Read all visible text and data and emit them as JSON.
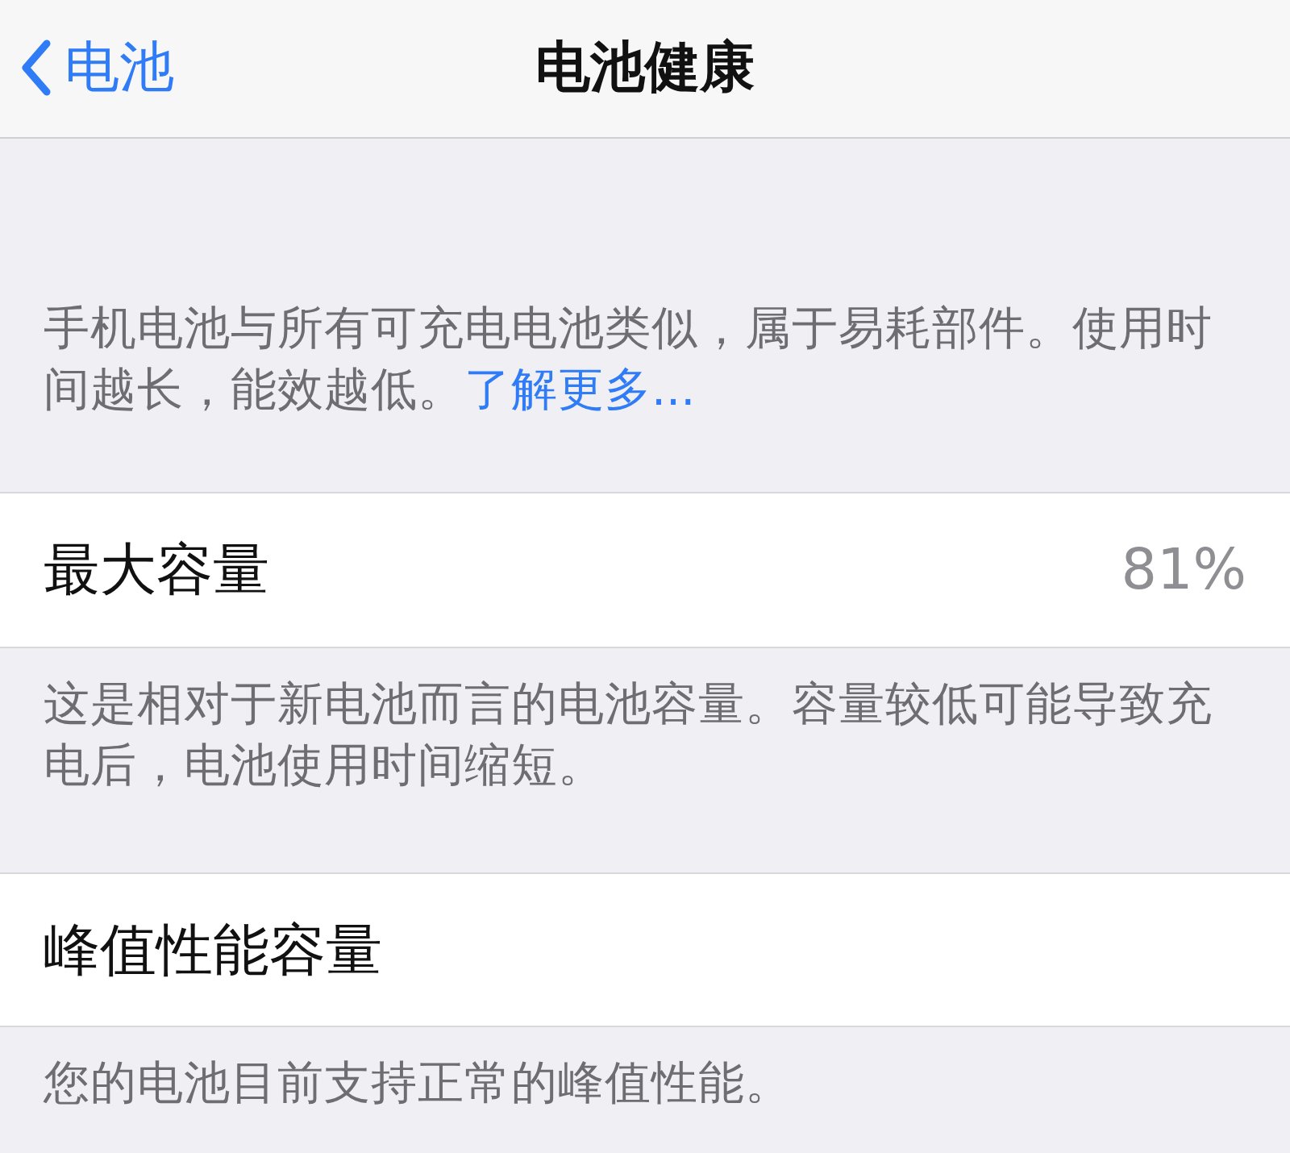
{
  "nav_bar": {
    "back_label": "电池",
    "title": "电池健康"
  },
  "intro": {
    "text": "手机电池与所有可充电电池类似，属于易耗部件。使用时间越长，能效越低。",
    "link": "了解更多..."
  },
  "sections": [
    {
      "label": "最大容量",
      "value": "81%",
      "footer": "这是相对于新电池而言的电池容量。容量较低可能导致充电后，电池使用时间缩短。"
    },
    {
      "label": "峰值性能容量",
      "footer": "您的电池目前支持正常的峰值性能。"
    }
  ]
}
